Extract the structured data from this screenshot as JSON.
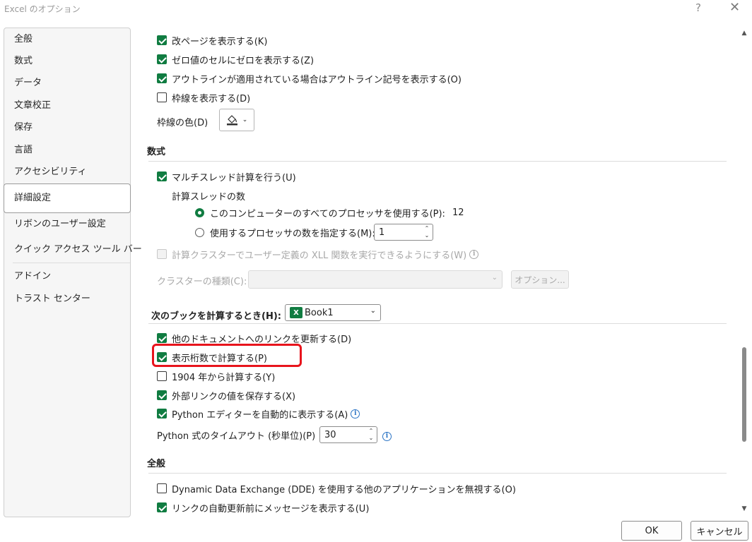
{
  "window": {
    "title": "Excel のオプション",
    "help": "?",
    "close": "✕"
  },
  "sidebar": {
    "items": [
      "全般",
      "数式",
      "データ",
      "文章校正",
      "保存",
      "言語",
      "アクセシビリティ",
      "詳細設定",
      "リボンのユーザー設定",
      "クイック アクセス ツール バー",
      "アドイン",
      "トラスト センター"
    ],
    "active_index": 7
  },
  "display": {
    "page_breaks": {
      "label": "改ページを表示する(K)",
      "checked": true
    },
    "zero_values": {
      "label": "ゼロ値のセルにゼロを表示する(Z)",
      "checked": true
    },
    "outline": {
      "label": "アウトラインが適用されている場合はアウトライン記号を表示する(O)",
      "checked": true
    },
    "gridlines": {
      "label": "枠線を表示する(D)",
      "checked": false
    },
    "gridline_color_label": "枠線の色(D)"
  },
  "formulas": {
    "title": "数式",
    "multithread": {
      "label": "マルチスレッド計算を行う(U)",
      "checked": true
    },
    "thread_count_label": "計算スレッドの数",
    "use_all": {
      "label": "このコンピューターのすべてのプロセッサを使用する(P):",
      "value": "12",
      "selected": true
    },
    "manual": {
      "label": "使用するプロセッサの数を指定する(M):",
      "value": "1",
      "selected": false
    },
    "xll": {
      "label": "計算クラスターでユーザー定義の XLL 関数を実行できるようにする(W)",
      "checked": false
    },
    "cluster_type_label": "クラスターの種類(C):",
    "options_button": "オプション..."
  },
  "workbook": {
    "label": "次のブックを計算するとき(H):",
    "book_name": "Book1",
    "xl_letter": "X",
    "update_links": {
      "label": "他のドキュメントへのリンクを更新する(D)",
      "checked": true
    },
    "precision": {
      "label": "表示桁数で計算する(P)",
      "checked": true
    },
    "date1904": {
      "label": "1904 年から計算する(Y)",
      "checked": false
    },
    "save_external": {
      "label": "外部リンクの値を保存する(X)",
      "checked": true
    },
    "python_editor": {
      "label": "Python エディターを自動的に表示する(A)",
      "checked": true
    },
    "python_timeout_label": "Python 式のタイムアウト (秒単位)(P)",
    "python_timeout_value": "30"
  },
  "general": {
    "title": "全般",
    "dde": {
      "label": "Dynamic Data Exchange (DDE) を使用する他のアプリケーションを無視する(O)",
      "checked": false
    },
    "ask_update": {
      "label": "リンクの自動更新前にメッセージを表示する(U)",
      "checked": true
    }
  },
  "footer": {
    "ok": "OK",
    "cancel": "キャンセル"
  },
  "colors": {
    "accent": "#107c41",
    "highlight": "#e8141c",
    "info": "#2a73c4"
  }
}
